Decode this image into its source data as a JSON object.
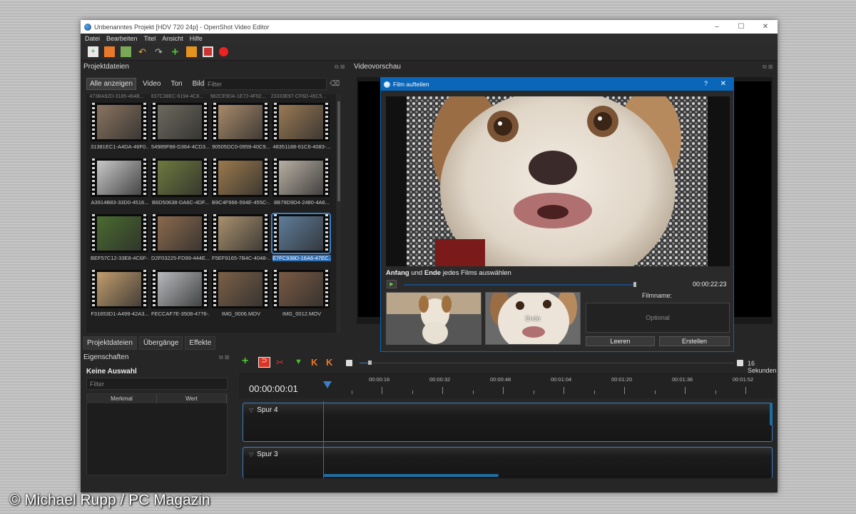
{
  "window": {
    "title": "Unbenanntes Projekt [HDV 720 24p] - OpenShot Video Editor",
    "controls": [
      "–",
      "☐",
      "✕"
    ]
  },
  "menu": [
    "Datei",
    "Bearbeiten",
    "Titel",
    "Ansicht",
    "Hilfe"
  ],
  "project_files": {
    "title": "Projektdateien",
    "filters": [
      "Alle anzeigen",
      "Video",
      "Ton",
      "Bild"
    ],
    "filter_placeholder": "Filter",
    "cut_labels": [
      "473BA92D-3185-464B...",
      "837C38EC-6194-4C8...",
      "982CE9DA-1E72-4F92...",
      "23333E97-CF6D-45C5..."
    ],
    "files": [
      {
        "name": "31381EC1-A4DA-46F0...",
        "color": "#8a7460"
      },
      {
        "name": "54989F88-D364-4CD3...",
        "color": "#6d6a5e"
      },
      {
        "name": "90505DC0-0959-40C9...",
        "color": "#a88a6a"
      },
      {
        "name": "48351188-61C6-4083-...",
        "color": "#9a7a55"
      },
      {
        "name": "A3914B83-33D0-4516...",
        "color": "#c9c9c9"
      },
      {
        "name": "B6D50638-DA6C-4DF...",
        "color": "#6e7a3e"
      },
      {
        "name": "B9C4F666-594E-455C-...",
        "color": "#9b7a4d"
      },
      {
        "name": "8B79D9D4-2480-4A6...",
        "color": "#b9b0a4"
      },
      {
        "name": "BEF57C12-33E8-4C6F-...",
        "color": "#4a6b2f"
      },
      {
        "name": "D2F03225-FD99-444E...",
        "color": "#8b6a4e"
      },
      {
        "name": "F5EF9165-7B4C-4048-...",
        "color": "#a9916e"
      },
      {
        "name": "E7FC938D-16A6-47EC...",
        "color": "#5f7d9b",
        "selected": true
      },
      {
        "name": "F31653D1-A499-42A3...",
        "color": "#c29d6f"
      },
      {
        "name": "FECCAF7E-3508-4776-...",
        "color": "#b7babd"
      },
      {
        "name": "IMG_0006.MOV",
        "color": "#7b6048"
      },
      {
        "name": "IMG_0012.MOV",
        "color": "#7a5a44"
      }
    ],
    "tabs": [
      "Projektdateien",
      "Übergänge",
      "Effekte"
    ]
  },
  "properties": {
    "title": "Eigenschaften",
    "selection": "Keine Auswahl",
    "filter_placeholder": "Filter",
    "col_feature": "Merkmal",
    "col_value": "Wert"
  },
  "preview": {
    "title": "Videovorschau"
  },
  "dialog": {
    "title": "Film aufteilen",
    "help": "?",
    "close": "✕",
    "caption_start": "Anfang",
    "caption_and": "und",
    "caption_end": "Ende",
    "caption_rest": "jedes Films auswählen",
    "time": "00:00:22:23",
    "end_tag": "Ende",
    "filename_label": "Filmname:",
    "filename_placeholder": "Optional",
    "btn_clear": "Leeren",
    "btn_create": "Erstellen"
  },
  "timeline": {
    "zoom_label": "16 Sekunden",
    "current_time": "00:00:00:01",
    "ticks": [
      "00:00:16",
      "00:00:32",
      "00:00:48",
      "00:01:04",
      "00:01:20",
      "00:01:36",
      "00:01:52"
    ],
    "tracks": [
      "Spur 4",
      "Spur 3"
    ]
  },
  "watermark": "© Michael Rupp / PC Magazin",
  "colors": {
    "accent": "#3b7fc4",
    "dialog_title": "#0a66b8",
    "playhead": "#dd3333"
  }
}
